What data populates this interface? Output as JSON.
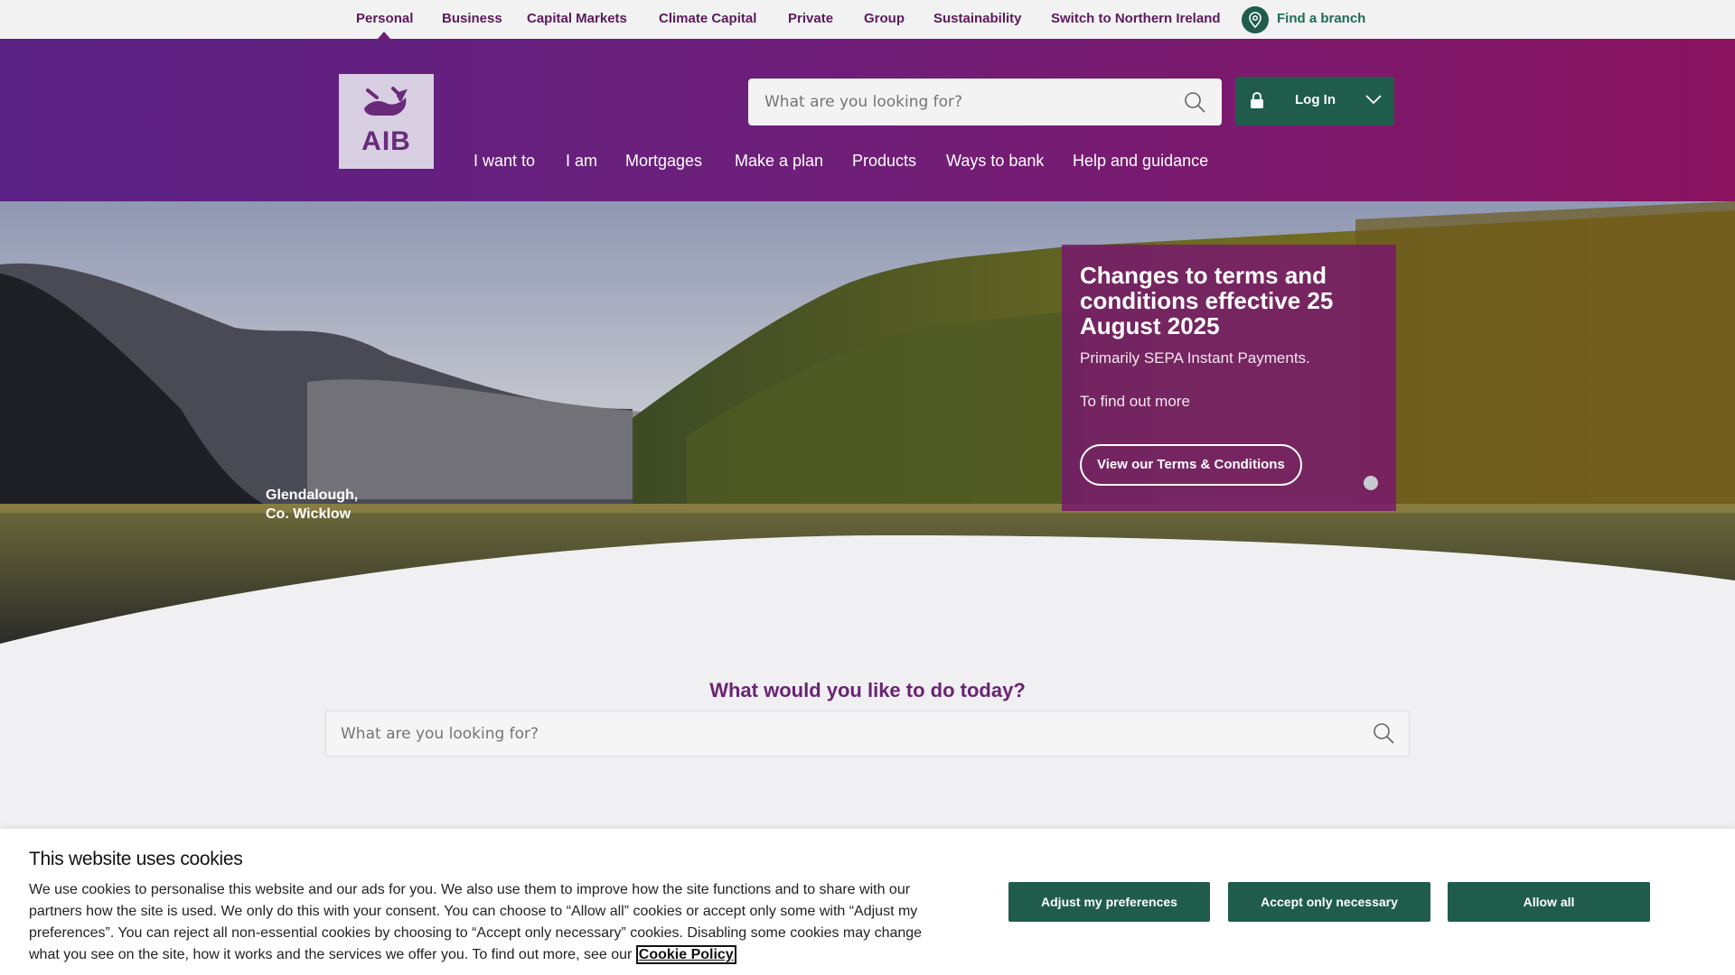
{
  "topbar": {
    "items": [
      "Personal",
      "Business",
      "Capital Markets",
      "Climate Capital",
      "Private",
      "Group",
      "Sustainability",
      "Switch to Northern Ireland"
    ],
    "active": "Personal",
    "find_branch": "Find a branch"
  },
  "header": {
    "logo_text": "AIB",
    "search_placeholder": "What are you looking for?",
    "login_label": "Log In",
    "nav": [
      "I want to",
      "I am",
      "Mortgages",
      "Make a plan",
      "Products",
      "Ways to bank",
      "Help and guidance"
    ]
  },
  "hero": {
    "caption_line1": "Glendalough,",
    "caption_line2": "Co. Wicklow",
    "promo": {
      "title": "Changes to terms and conditions effective 25 August 2025",
      "text1": "Primarily SEPA Instant Payments.",
      "text2": "To find out more",
      "cta": "View our Terms & Conditions"
    }
  },
  "today": {
    "title": "What would you like to do today?",
    "search_placeholder": "What are you looking for?"
  },
  "cookie": {
    "title": "This website uses cookies",
    "text": "We use cookies to personalise this website and our ads for you. We also use them to improve how the site functions and to share with our partners how the site is used. We only do this with your consent. You can choose to “Allow all” cookies or accept only some with “Adjust my preferences”. You can reject all non-essential cookies by choosing to “Accept only necessary” cookies. Disabling some cookies may change what you see on the site, how it works and the services we offer you. To find out more, see our",
    "policy_link": "Cookie Policy",
    "btn_adjust": "Adjust my preferences",
    "btn_necessary": "Accept only necessary",
    "btn_allow": "Allow all"
  },
  "colors": {
    "brand_purple": "#6d1f7a",
    "brand_green": "#1f5c4c",
    "topbar_bg": "#f2f2f3"
  }
}
